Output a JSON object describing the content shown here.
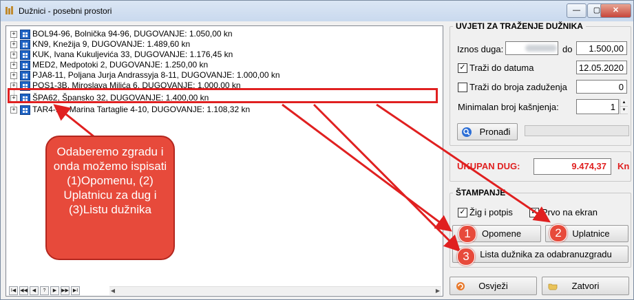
{
  "window": {
    "title": "Dužnici - posebni prostori",
    "minimize": "—",
    "maximize": "▢",
    "close": "✕"
  },
  "tree": {
    "items": [
      {
        "text": "BOL94-96, Bolnička 94-96,  DUGOVANJE: 1.050,00 kn"
      },
      {
        "text": "KN9, Knežija 9,  DUGOVANJE: 1.489,60 kn"
      },
      {
        "text": "KUK, Ivana Kukuljevića 33,  DUGOVANJE: 1.176,45 kn"
      },
      {
        "text": "MED2, Medpotoki 2,  DUGOVANJE: 1.250,00 kn"
      },
      {
        "text": "PJA8-11, Poljana Jurja Andrassyja 8-11,  DUGOVANJE: 1.000,00 kn"
      },
      {
        "text": "POS1-3B, Miroslava Milića 6,  DUGOVANJE: 1.000,00 kn"
      },
      {
        "text": "ŠPA62, Špansko 32,  DUGOVANJE: 1.400,00 kn"
      },
      {
        "text": "TAR4-10, Marina Tartaglie 4-10,  DUGOVANJE: 1.108,32 kn"
      }
    ],
    "expander": "+",
    "pager": [
      "I◀",
      "◀◀",
      "◀",
      "?",
      "▶",
      "▶▶",
      "▶I"
    ]
  },
  "search": {
    "title": "UVJETI ZA TRAŽENJE DUŽNIKA",
    "amount_label": "Iznos duga:",
    "to_label": "do",
    "amount_to": "1.500,00",
    "date_check_label": "Traži do datuma",
    "date_checked": "✓",
    "date_value": "12.05.2020",
    "count_check_label": "Traži do broja zaduženja",
    "count_value": "0",
    "min_delay_label": "Minimalan broj kašnjenja:",
    "min_delay_value": "1",
    "find_button": "Pronađi"
  },
  "total": {
    "label": "UKUPAN DUG:",
    "value": "9.474,37",
    "currency": "Kn"
  },
  "print": {
    "title": "ŠTAMPANJE",
    "stamp_label": "Žig i potpis",
    "stamp_checked": "✓",
    "screen_label": "Prvo na ekran",
    "screen_checked": "✓",
    "reminders_button": "Opomene",
    "payslips_button": "Uplatnice",
    "list_button": "Lista dužnika za odabranuzgradu"
  },
  "actions": {
    "refresh_button": "Osvježi",
    "close_button": "Zatvori"
  },
  "annotation": {
    "callout": "Odaberemo zgradu i onda možemo ispisati (1)Opomenu, (2) Uplatnicu za dug i (3)Listu dužnika",
    "badge1": "1",
    "badge2": "2",
    "badge3": "3"
  },
  "colors": {
    "accent_red": "#e02020",
    "node_icon": "#1e63c4"
  }
}
